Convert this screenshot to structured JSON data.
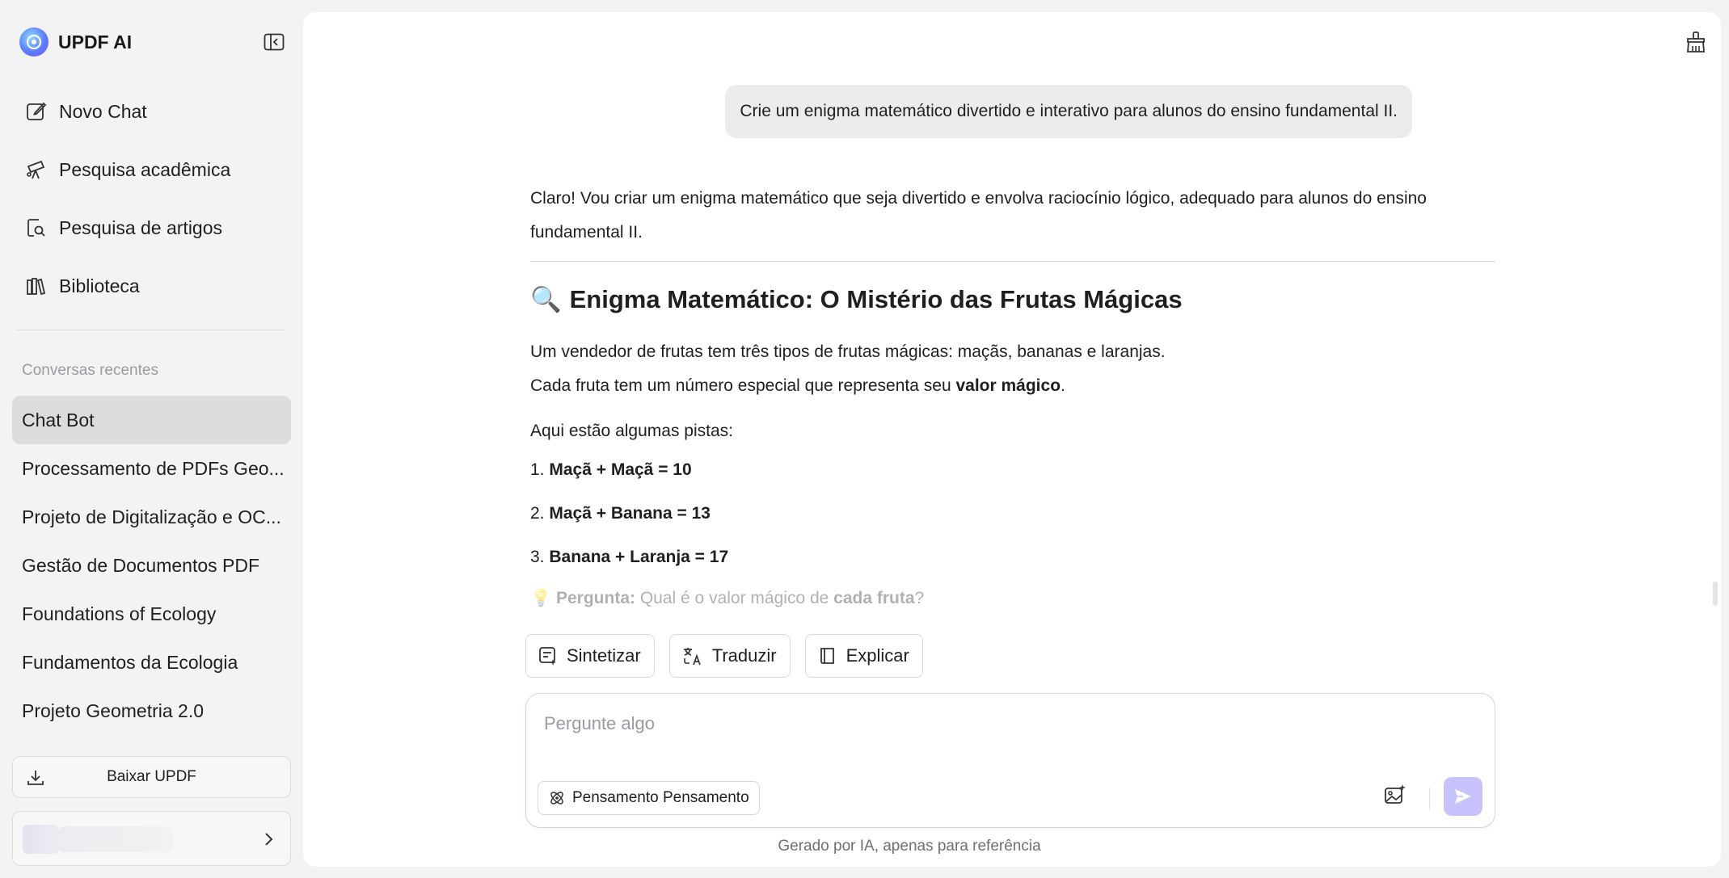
{
  "brand": {
    "name": "UPDF AI"
  },
  "nav": {
    "items": [
      {
        "label": "Novo Chat",
        "icon": "edit-icon"
      },
      {
        "label": "Pesquisa acadêmica",
        "icon": "telescope-icon"
      },
      {
        "label": "Pesquisa de artigos",
        "icon": "article-search-icon"
      },
      {
        "label": "Biblioteca",
        "icon": "library-icon"
      }
    ]
  },
  "recent": {
    "label": "Conversas recentes",
    "items": [
      "Chat Bot",
      "Processamento de PDFs Geo...",
      "Projeto de Digitalização e OC...",
      "Gestão de Documentos PDF",
      "Foundations of Ecology",
      "Fundamentos da Ecologia",
      "Projeto Geometria 2.0"
    ],
    "active_index": 0
  },
  "download": {
    "label": "Baixar UPDF"
  },
  "chat": {
    "user_message": "Crie um enigma matemático divertido e interativo para alunos do ensino fundamental II.",
    "answer": {
      "intro": "Claro! Vou criar um enigma matemático que seja divertido e envolva raciocínio lógico, adequado para alunos do ensino fundamental II.",
      "title_emoji": "🔍",
      "title": "Enigma Matemático: O Mistério das Frutas Mágicas",
      "p1": "Um vendedor de frutas tem três tipos de frutas mágicas: maçãs, bananas e laranjas.",
      "p1b_prefix": "Cada fruta tem um número especial que representa seu ",
      "p1b_bold": "valor mágico",
      "p1b_suffix": ".",
      "p2": "Aqui estão algumas pistas:",
      "clues": [
        {
          "num": "1.",
          "text": "Maçã + Maçã = 10"
        },
        {
          "num": "2.",
          "text": "Maçã + Banana = 13"
        },
        {
          "num": "3.",
          "text": "Banana + Laranja = 17"
        }
      ],
      "question_emoji": "💡",
      "question_label": "Pergunta:",
      "question_text": " Qual é o valor mágico de ",
      "question_bold": "cada fruta",
      "question_end": "?"
    }
  },
  "actions": {
    "summarize": "Sintetizar",
    "translate": "Traduzir",
    "explain": "Explicar"
  },
  "composer": {
    "placeholder": "Pergunte algo",
    "value": "",
    "think_label": "Pensamento Pensamento"
  },
  "footer": {
    "note": "Gerado por IA, apenas para referência"
  },
  "colors": {
    "accent": "#c8c2ff",
    "active_item": "#dcdcde",
    "bubble": "#ececee"
  }
}
